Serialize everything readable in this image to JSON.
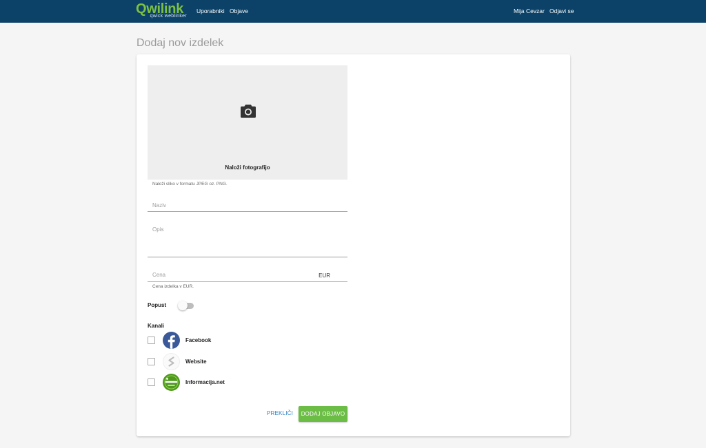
{
  "header": {
    "logo_word": "Qwilink",
    "logo_tagline": "qwick weblinker",
    "nav": [
      {
        "label": "Uporabniki"
      },
      {
        "label": "Objave"
      }
    ],
    "user_name": "Mija Cevzar",
    "logout_label": "Odjavi se"
  },
  "page": {
    "title": "Dodaj nov izdelek"
  },
  "form": {
    "upload": {
      "icon": "camera-icon",
      "label": "Naloži fotografijo",
      "helper": "Naloži sliko v formatu JPEG oz. PNG."
    },
    "name": {
      "placeholder": "Naziv",
      "value": ""
    },
    "description": {
      "placeholder": "Opis",
      "value": ""
    },
    "price": {
      "placeholder": "Cena",
      "value": "",
      "suffix": "EUR",
      "helper": "Cena izdelka v EUR."
    },
    "discount": {
      "label": "Popust",
      "enabled": false
    },
    "channels": {
      "label": "Kanali",
      "items": [
        {
          "name": "Facebook",
          "icon": "facebook-icon",
          "checked": false
        },
        {
          "name": "Website",
          "icon": "website-icon",
          "checked": false
        },
        {
          "name": "Informacija.net",
          "icon": "informacija-icon",
          "checked": false
        }
      ]
    },
    "cancel_label": "Prekliči",
    "submit_label": "Dodaj objavo"
  },
  "colors": {
    "navbar": "#0c4268",
    "brand_green": "#7cc143",
    "button_green": "#6cbd45",
    "link_blue": "#2a7fc4",
    "facebook_blue": "#3b5998"
  }
}
